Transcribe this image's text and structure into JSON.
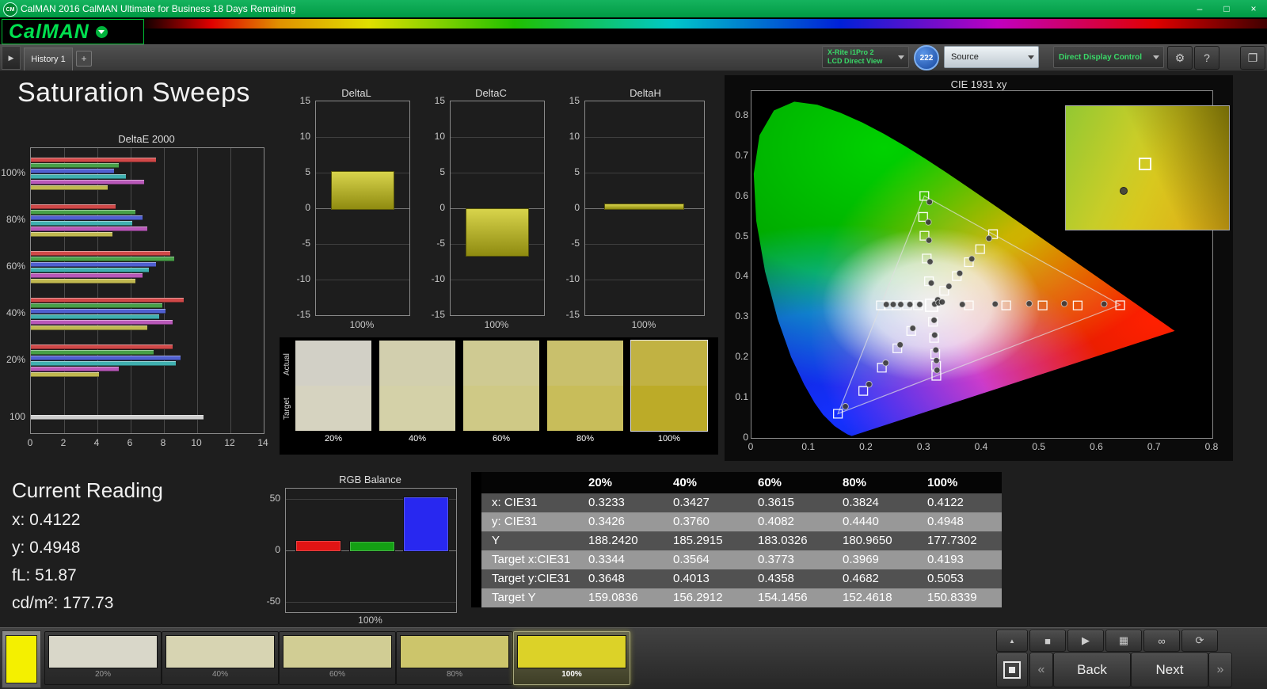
{
  "titlebar": {
    "icon": "CM",
    "title": "CalMAN 2016 CalMAN Ultimate for Business 18 Days Remaining"
  },
  "logo": {
    "text": "CalMAN"
  },
  "tabbar": {
    "history_tab": "History 1",
    "add_tab": "+"
  },
  "toolbar": {
    "meter_line1": "X-Rite i1Pro 2",
    "meter_line2": "LCD Direct View",
    "meter_badge": "222",
    "source": "Source",
    "display_control": "Direct Display Control"
  },
  "icons": {
    "dropdown": "▾",
    "gear": "⚙",
    "help": "?",
    "workspace": "❐",
    "panel_arrow": "▶",
    "eject": "▲",
    "stop": "■",
    "play": "▶",
    "pattern": "▦",
    "continuous": "∞",
    "loop": "⟳",
    "prev": "«",
    "next": "»",
    "minimize": "–",
    "maximize": "□",
    "close": "×"
  },
  "page_title": "Saturation Sweeps",
  "current_reading": {
    "title": "Current Reading",
    "lines": [
      "x: 0.4122",
      "y: 0.4948",
      "fL: 51.87",
      "cd/m²: 177.73"
    ]
  },
  "data_table": {
    "columns": [
      "20%",
      "40%",
      "60%",
      "80%",
      "100%"
    ],
    "rows": [
      {
        "label": "x: CIE31",
        "values": [
          "0.3233",
          "0.3427",
          "0.3615",
          "0.3824",
          "0.4122"
        ]
      },
      {
        "label": "y: CIE31",
        "values": [
          "0.3426",
          "0.3760",
          "0.4082",
          "0.4440",
          "0.4948"
        ]
      },
      {
        "label": "Y",
        "values": [
          "188.2420",
          "185.2915",
          "183.0326",
          "180.9650",
          "177.7302"
        ]
      },
      {
        "label": "Target x:CIE31",
        "values": [
          "0.3344",
          "0.3564",
          "0.3773",
          "0.3969",
          "0.4193"
        ]
      },
      {
        "label": "Target y:CIE31",
        "values": [
          "0.3648",
          "0.4013",
          "0.4358",
          "0.4682",
          "0.5053"
        ]
      },
      {
        "label": "Target Y",
        "values": [
          "159.0836",
          "156.2912",
          "154.1456",
          "152.4618",
          "150.8339"
        ]
      }
    ]
  },
  "swatch_strip": {
    "row_labels": [
      "Actual",
      "Target"
    ],
    "items": [
      {
        "label": "20%",
        "actual": "#d2d0c6",
        "target": "#d6d3c0",
        "selected": false
      },
      {
        "label": "40%",
        "actual": "#d2cfae",
        "target": "#d4d1a8",
        "selected": false
      },
      {
        "label": "60%",
        "actual": "#cfca92",
        "target": "#cfc986",
        "selected": false
      },
      {
        "label": "80%",
        "actual": "#c9c06c",
        "target": "#c8bd5a",
        "selected": false
      },
      {
        "label": "100%",
        "actual": "#c1b243",
        "target": "#bcab28",
        "selected": true
      }
    ]
  },
  "patch_bar": {
    "current_color": "#f4f000",
    "patches": [
      {
        "label": "20%",
        "color": "#d9d7c9",
        "selected": false
      },
      {
        "label": "40%",
        "color": "#d7d4b2",
        "selected": false
      },
      {
        "label": "60%",
        "color": "#d1cd94",
        "selected": false
      },
      {
        "label": "80%",
        "color": "#ccc56b",
        "selected": false
      },
      {
        "label": "100%",
        "color": "#dcd228",
        "selected": true
      }
    ],
    "back": "Back",
    "next": "Next"
  },
  "chart_data": [
    {
      "id": "deltae2000",
      "type": "bar",
      "orientation": "horizontal",
      "title": "DeltaE 2000",
      "xlim": [
        0,
        14
      ],
      "xticks": [
        0,
        2,
        4,
        6,
        8,
        10,
        12,
        14
      ],
      "bar_colors": {
        "red": "#d04848",
        "green": "#48a048",
        "blue": "#5060d0",
        "cyan": "#40b0b0",
        "magenta": "#b858b8",
        "yellow": "#c0b850",
        "gray": "#cccccc"
      },
      "groups": [
        {
          "label": "100%",
          "bars": [
            [
              "red",
              7.5
            ],
            [
              "green",
              5.3
            ],
            [
              "blue",
              5.0
            ],
            [
              "cyan",
              5.7
            ],
            [
              "magenta",
              6.8
            ],
            [
              "yellow",
              4.6
            ]
          ]
        },
        {
          "label": "80%",
          "bars": [
            [
              "red",
              5.1
            ],
            [
              "green",
              6.3
            ],
            [
              "blue",
              6.7
            ],
            [
              "cyan",
              6.1
            ],
            [
              "magenta",
              7.0
            ],
            [
              "yellow",
              4.9
            ]
          ]
        },
        {
          "label": "60%",
          "bars": [
            [
              "red",
              8.4
            ],
            [
              "green",
              8.6
            ],
            [
              "blue",
              7.5
            ],
            [
              "cyan",
              7.1
            ],
            [
              "magenta",
              6.7
            ],
            [
              "yellow",
              6.3
            ]
          ]
        },
        {
          "label": "40%",
          "bars": [
            [
              "red",
              9.2
            ],
            [
              "green",
              7.9
            ],
            [
              "blue",
              8.1
            ],
            [
              "cyan",
              7.7
            ],
            [
              "magenta",
              8.5
            ],
            [
              "yellow",
              7.0
            ]
          ]
        },
        {
          "label": "20%",
          "bars": [
            [
              "red",
              8.5
            ],
            [
              "green",
              7.4
            ],
            [
              "blue",
              9.0
            ],
            [
              "cyan",
              8.7
            ],
            [
              "magenta",
              5.3
            ],
            [
              "yellow",
              4.1
            ]
          ]
        },
        {
          "label": "100",
          "bars": [
            [
              "gray",
              10.4
            ]
          ]
        }
      ]
    },
    {
      "id": "deltaL",
      "type": "bar",
      "title": "DeltaL",
      "ylim": [
        -15,
        15
      ],
      "yticks": [
        15,
        10,
        5,
        0,
        -5,
        -10,
        -15
      ],
      "categories": [
        "100%"
      ],
      "values": [
        5.2
      ],
      "bar_color": "#b6b81e"
    },
    {
      "id": "deltaC",
      "type": "bar",
      "title": "DeltaC",
      "ylim": [
        -15,
        15
      ],
      "yticks": [
        15,
        10,
        5,
        0,
        -5,
        -10,
        -15
      ],
      "categories": [
        "100%"
      ],
      "values": [
        -6.6
      ],
      "bar_color": "#b6b81e"
    },
    {
      "id": "deltaH",
      "type": "bar",
      "title": "DeltaH",
      "ylim": [
        -15,
        15
      ],
      "yticks": [
        15,
        10,
        5,
        0,
        -5,
        -10,
        -15
      ],
      "categories": [
        "100%"
      ],
      "values": [
        0.7
      ],
      "bar_color": "#b6b81e"
    },
    {
      "id": "rgb_balance",
      "type": "bar",
      "title": "RGB Balance",
      "ylim": [
        -60,
        60
      ],
      "yticks": [
        50,
        0,
        -50
      ],
      "categories": [
        "Red",
        "Green",
        "Blue"
      ],
      "values": [
        10,
        9,
        52
      ],
      "colors": [
        "#e01414",
        "#14a014",
        "#2828f0"
      ],
      "xlabel": "100%"
    },
    {
      "id": "cie1931",
      "type": "scatter",
      "title": "CIE 1931 xy",
      "xlim": [
        0,
        0.8
      ],
      "ylim": [
        0,
        0.8
      ],
      "xticks": [
        0,
        0.1,
        0.2,
        0.3,
        0.4,
        0.5,
        0.6,
        0.7,
        0.8
      ],
      "yticks": [
        0,
        0.1,
        0.2,
        0.3,
        0.4,
        0.5,
        0.6,
        0.7,
        0.8
      ],
      "gamut_triangle": [
        [
          0.64,
          0.33
        ],
        [
          0.3,
          0.6
        ],
        [
          0.15,
          0.06
        ]
      ],
      "white_point": [
        0.3127,
        0.329
      ],
      "targets": [
        [
          0.3774,
          0.3288
        ],
        [
          0.4421,
          0.3287
        ],
        [
          0.5053,
          0.3286
        ],
        [
          0.5662,
          0.3285
        ],
        [
          0.64,
          0.329
        ],
        [
          0.3081,
          0.3884
        ],
        [
          0.3042,
          0.4448
        ],
        [
          0.3003,
          0.5013
        ],
        [
          0.298,
          0.548
        ],
        [
          0.3,
          0.6
        ],
        [
          0.2773,
          0.2653
        ],
        [
          0.2532,
          0.2222
        ],
        [
          0.2263,
          0.1742
        ],
        [
          0.194,
          0.1166
        ],
        [
          0.15,
          0.06
        ],
        [
          0.289,
          0.329
        ],
        [
          0.27,
          0.329
        ],
        [
          0.252,
          0.3289
        ],
        [
          0.238,
          0.3288
        ],
        [
          0.2246,
          0.3287
        ],
        [
          0.315,
          0.288
        ],
        [
          0.317,
          0.248
        ],
        [
          0.319,
          0.208
        ],
        [
          0.3205,
          0.179
        ],
        [
          0.3209,
          0.1542
        ],
        [
          0.3344,
          0.3648
        ],
        [
          0.3564,
          0.4013
        ],
        [
          0.3773,
          0.4358
        ],
        [
          0.3969,
          0.4682
        ],
        [
          0.4193,
          0.5053
        ]
      ],
      "measurements": [
        [
          0.3233,
          0.3426
        ],
        [
          0.3427,
          0.376
        ],
        [
          0.3615,
          0.4082
        ],
        [
          0.3824,
          0.444
        ],
        [
          0.4122,
          0.4948
        ],
        [
          0.366,
          0.331
        ],
        [
          0.423,
          0.332
        ],
        [
          0.482,
          0.333
        ],
        [
          0.543,
          0.333
        ],
        [
          0.612,
          0.332
        ],
        [
          0.312,
          0.384
        ],
        [
          0.31,
          0.437
        ],
        [
          0.308,
          0.49
        ],
        [
          0.307,
          0.535
        ],
        [
          0.309,
          0.585
        ],
        [
          0.28,
          0.272
        ],
        [
          0.258,
          0.231
        ],
        [
          0.233,
          0.186
        ],
        [
          0.204,
          0.133
        ],
        [
          0.163,
          0.078
        ],
        [
          0.292,
          0.331
        ],
        [
          0.275,
          0.331
        ],
        [
          0.259,
          0.331
        ],
        [
          0.246,
          0.331
        ],
        [
          0.234,
          0.331
        ],
        [
          0.317,
          0.292
        ],
        [
          0.318,
          0.255
        ],
        [
          0.32,
          0.218
        ],
        [
          0.321,
          0.192
        ],
        [
          0.322,
          0.168
        ],
        [
          0.318,
          0.332
        ],
        [
          0.325,
          0.335
        ],
        [
          0.331,
          0.337
        ]
      ],
      "inset": {
        "square": [
          0.48,
          0.46
        ],
        "dot": [
          0.35,
          0.68
        ]
      }
    }
  ]
}
